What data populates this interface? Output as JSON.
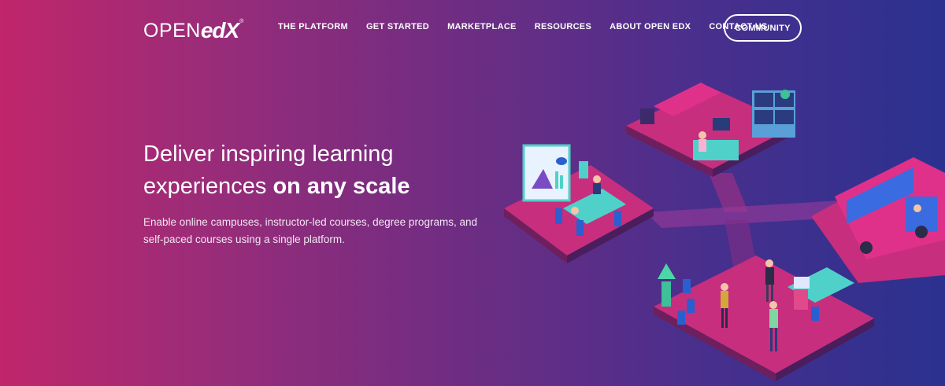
{
  "brand": {
    "logo_open": "OPEN",
    "logo_edx": "edX",
    "logo_reg": "®"
  },
  "nav": {
    "items": [
      {
        "label": "THE PLATFORM"
      },
      {
        "label": "GET STARTED"
      },
      {
        "label": "MARKETPLACE"
      },
      {
        "label": "RESOURCES"
      },
      {
        "label": "ABOUT OPEN EDX"
      },
      {
        "label": "CONTACT US"
      }
    ],
    "cta_label": "COMMUNITY"
  },
  "hero": {
    "title_line1": "Deliver inspiring learning",
    "title_line2_normal": "experiences",
    "title_line2_bold": "on any scale",
    "subtitle": "Enable online campuses, instructor-led courses, degree programs, and self-paced courses using a single platform."
  },
  "colors": {
    "gradient_left": "#c0266a",
    "gradient_mid": "#6c2d83",
    "gradient_right": "#2b318f",
    "platform_pink": "#c72e7e",
    "furniture_teal": "#4fd1c9",
    "chair_blue": "#2a5fd0"
  }
}
